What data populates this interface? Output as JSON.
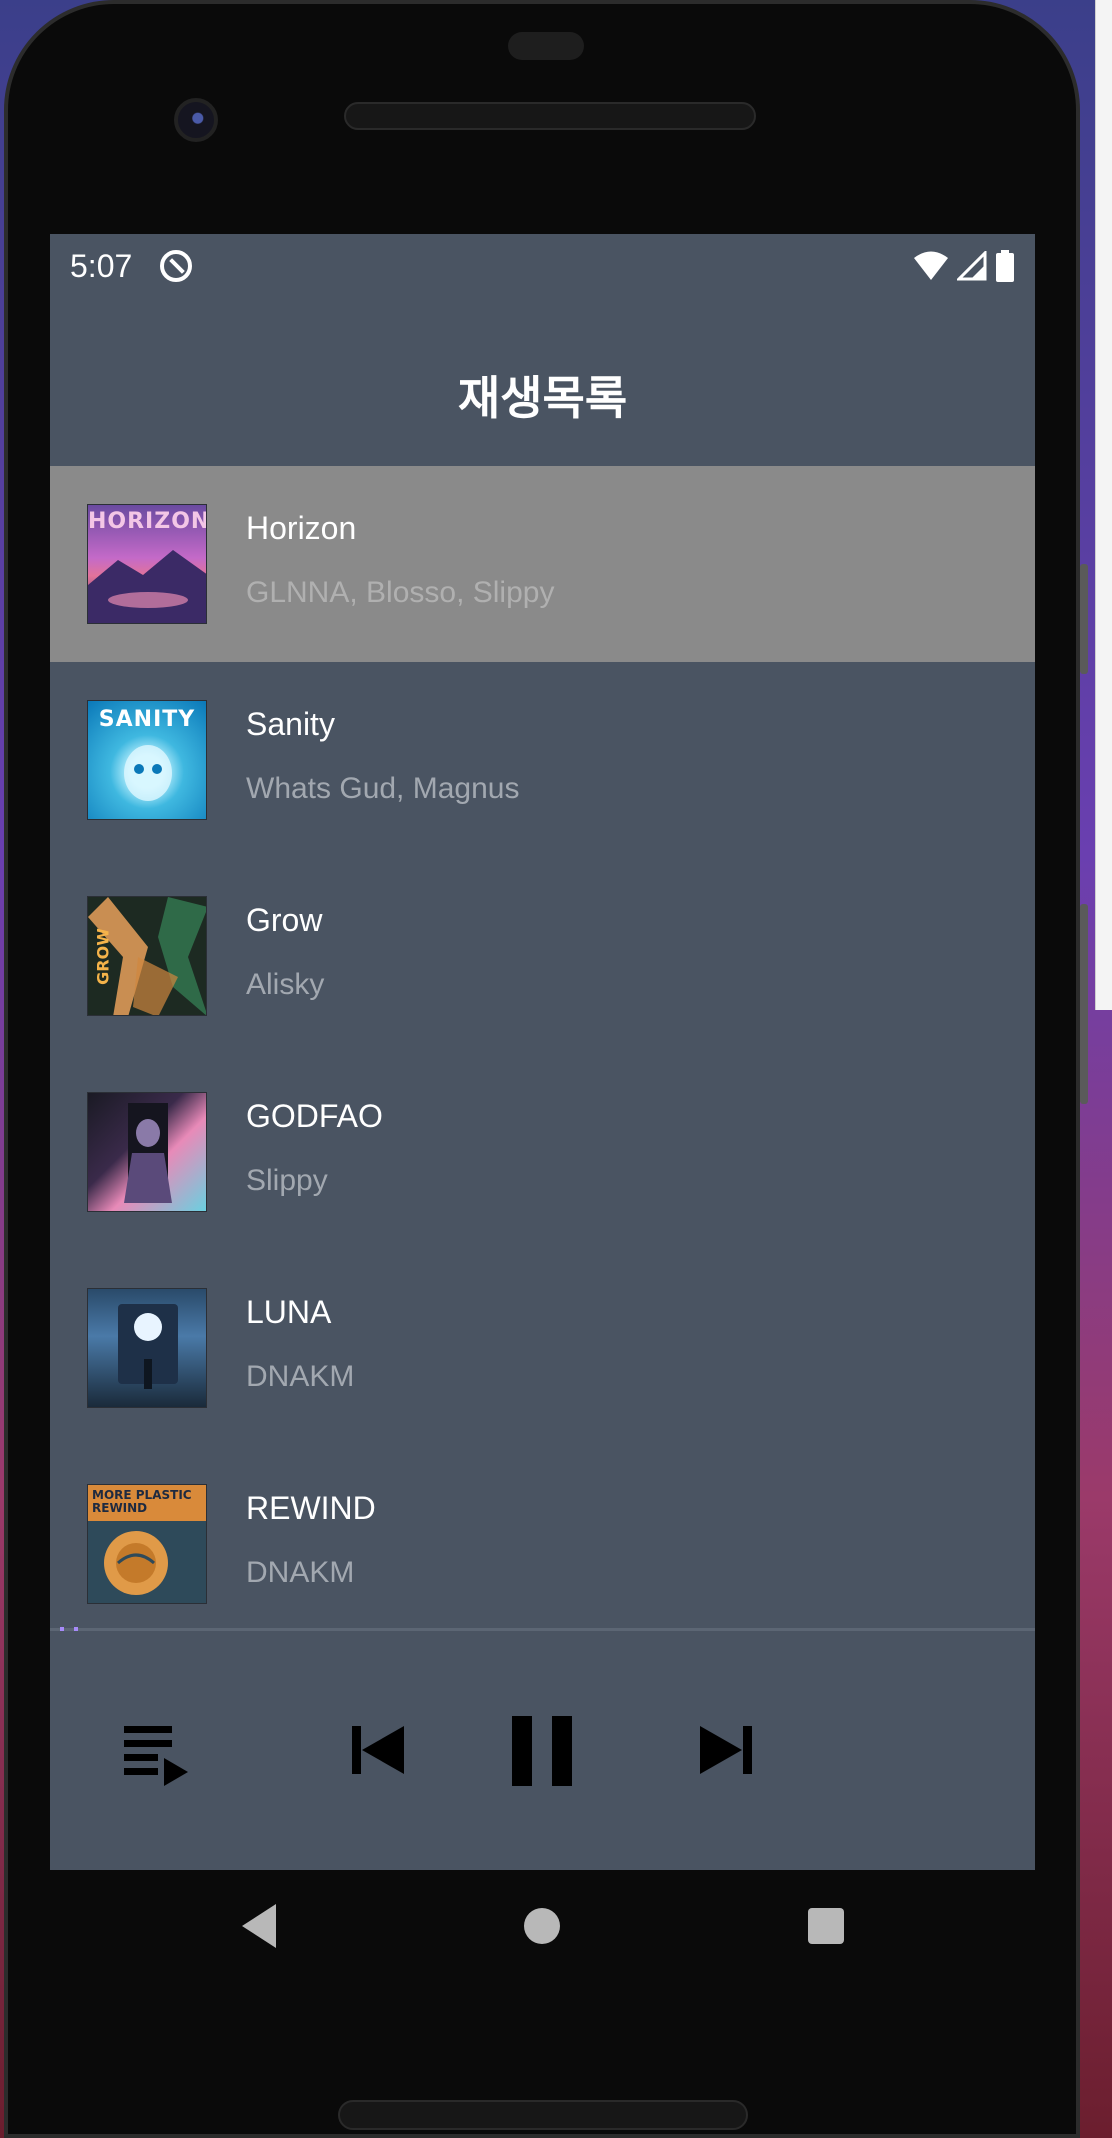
{
  "status_bar": {
    "time": "5:07",
    "icons": [
      "app-notification-icon",
      "wifi-icon",
      "signal-icon",
      "battery-icon"
    ]
  },
  "header": {
    "title": "재생목록"
  },
  "tracks": [
    {
      "title": "Horizon",
      "artist": "GLNNA, Blosso, Slippy",
      "art_text": "HORIZON",
      "selected": true
    },
    {
      "title": "Sanity",
      "artist": "Whats Gud, Magnus",
      "art_text": "SANITY",
      "selected": false
    },
    {
      "title": "Grow",
      "artist": "Alisky",
      "art_text": "GROW",
      "selected": false
    },
    {
      "title": "GODFAO",
      "artist": "Slippy",
      "art_text": "",
      "selected": false
    },
    {
      "title": "LUNA",
      "artist": "DNAKM",
      "art_text": "",
      "selected": false
    },
    {
      "title": "REWIND",
      "artist": "DNAKM",
      "art_text": "MORE PLASTIC REWIND",
      "selected": false
    }
  ],
  "player": {
    "progress": 0.02,
    "controls": [
      "playlist-icon",
      "skip-previous-icon",
      "pause-icon",
      "skip-next-icon"
    ]
  },
  "colors": {
    "screen_bg": "#4a5462",
    "selected_row": "#8a8a8a",
    "progress_accent": "#a78bfa"
  }
}
